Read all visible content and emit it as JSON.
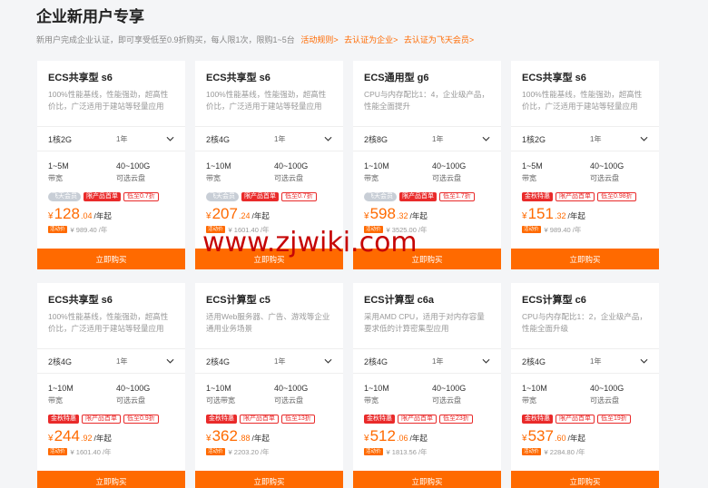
{
  "header": {
    "title": "企业新用户专享",
    "subtitle": "新用户完成企业认证，即可享受低至0.9折购买，每人限1次，限购1~5台",
    "links": [
      "活动规则>",
      "去认证为企业>",
      "去认证为飞天会员>"
    ]
  },
  "buy_label": "立即购买",
  "colors": {
    "accent": "#ff6a00",
    "tag_red": "#e92a2a",
    "watermark": "#c60606"
  },
  "watermark": "www.zjwiki.com",
  "cards": [
    {
      "title": "ECS共享型 s6",
      "desc": "100%性能基线，性能强劲，超高性价比，广泛适用于建站等轻量应用",
      "config": "1核2G",
      "duration": "1年",
      "bandwidth": "1~5M",
      "bandwidth_label": "带宽",
      "disk": "40~100G",
      "disk_label": "可选云盘",
      "tags": [
        {
          "text": "飞天会员",
          "style": "gray"
        },
        {
          "text": "限产品首单",
          "style": "red"
        },
        {
          "text": "低至0.7折",
          "style": "outline"
        }
      ],
      "price_int": "128",
      "price_dec": ".04",
      "price_unit": "/年起",
      "badge": "活动价",
      "orig": "¥ 989.40 /年"
    },
    {
      "title": "ECS共享型 s6",
      "desc": "100%性能基线，性能强劲，超高性价比，广泛适用于建站等轻量应用",
      "config": "2核4G",
      "duration": "1年",
      "bandwidth": "1~10M",
      "bandwidth_label": "带宽",
      "disk": "40~100G",
      "disk_label": "可选云盘",
      "tags": [
        {
          "text": "飞天会员",
          "style": "gray"
        },
        {
          "text": "限产品首单",
          "style": "red"
        },
        {
          "text": "低至0.7折",
          "style": "outline"
        }
      ],
      "price_int": "207",
      "price_dec": ".24",
      "price_unit": "/年起",
      "badge": "活动价",
      "orig": "¥ 1601.40 /年"
    },
    {
      "title": "ECS通用型 g6",
      "desc": "CPU与内存配比1：4，企业级产品，性能全面提升",
      "config": "2核8G",
      "duration": "1年",
      "bandwidth": "1~10M",
      "bandwidth_label": "带宽",
      "disk": "40~100G",
      "disk_label": "可选云盘",
      "tags": [
        {
          "text": "飞天会员",
          "style": "gray"
        },
        {
          "text": "限产品首单",
          "style": "red"
        },
        {
          "text": "低至1.7折",
          "style": "outline"
        }
      ],
      "price_int": "598",
      "price_dec": ".32",
      "price_unit": "/年起",
      "badge": "活动价",
      "orig": "¥ 3525.00 /年"
    },
    {
      "title": "ECS共享型 s6",
      "desc": "100%性能基线，性能强劲，超高性价比，广泛适用于建站等轻量应用",
      "config": "1核2G",
      "duration": "1年",
      "bandwidth": "1~5M",
      "bandwidth_label": "带宽",
      "disk": "40~100G",
      "disk_label": "可选云盘",
      "tags": [
        {
          "text": "金秋特惠",
          "style": "red"
        },
        {
          "text": "限产品首单",
          "style": "outline"
        },
        {
          "text": "低至0.98折",
          "style": "outline"
        }
      ],
      "price_int": "151",
      "price_dec": ".32",
      "price_unit": "/年起",
      "badge": "活动价",
      "orig": "¥ 989.40 /年"
    },
    {
      "title": "ECS共享型 s6",
      "desc": "100%性能基线，性能强劲，超高性价比，广泛适用于建站等轻量应用",
      "config": "2核4G",
      "duration": "1年",
      "bandwidth": "1~10M",
      "bandwidth_label": "带宽",
      "disk": "40~100G",
      "disk_label": "可选云盘",
      "tags": [
        {
          "text": "金秋特惠",
          "style": "red"
        },
        {
          "text": "限产品首单",
          "style": "outline"
        },
        {
          "text": "低至0.9折",
          "style": "outline"
        }
      ],
      "price_int": "244",
      "price_dec": ".92",
      "price_unit": "/年起",
      "badge": "活动价",
      "orig": "¥ 1601.40 /年"
    },
    {
      "title": "ECS计算型 c5",
      "desc": "适用Web服务器、广告、游戏等企业通用业务场景",
      "config": "2核4G",
      "duration": "1年",
      "bandwidth": "1~10M",
      "bandwidth_label": "可选带宽",
      "disk": "40~100G",
      "disk_label": "可选云盘",
      "tags": [
        {
          "text": "金秋特惠",
          "style": "red"
        },
        {
          "text": "限产品首单",
          "style": "outline"
        },
        {
          "text": "低至13折",
          "style": "outline"
        }
      ],
      "price_int": "362",
      "price_dec": ".88",
      "price_unit": "/年起",
      "badge": "活动价",
      "orig": "¥ 2203.20 /年"
    },
    {
      "title": "ECS计算型 c6a",
      "desc": "采用AMD CPU，适用于对内存容量要求低的计算密集型应用",
      "config": "2核4G",
      "duration": "1年",
      "bandwidth": "1~10M",
      "bandwidth_label": "带宽",
      "disk": "40~100G",
      "disk_label": "可选云盘",
      "tags": [
        {
          "text": "金秋特惠",
          "style": "red"
        },
        {
          "text": "限产品首单",
          "style": "outline"
        },
        {
          "text": "低至23折",
          "style": "outline"
        }
      ],
      "price_int": "512",
      "price_dec": ".06",
      "price_unit": "/年起",
      "badge": "活动价",
      "orig": "¥ 1813.56 /年"
    },
    {
      "title": "ECS计算型 c6",
      "desc": "CPU与内存配比1：2，企业级产品，性能全面升级",
      "config": "2核4G",
      "duration": "1年",
      "bandwidth": "1~10M",
      "bandwidth_label": "带宽",
      "disk": "40~100G",
      "disk_label": "可选云盘",
      "tags": [
        {
          "text": "金秋特惠",
          "style": "red"
        },
        {
          "text": "限产品首单",
          "style": "outline"
        },
        {
          "text": "低至19折",
          "style": "outline"
        }
      ],
      "price_int": "537",
      "price_dec": ".60",
      "price_unit": "/年起",
      "badge": "活动价",
      "orig": "¥ 2284.80 /年"
    }
  ]
}
